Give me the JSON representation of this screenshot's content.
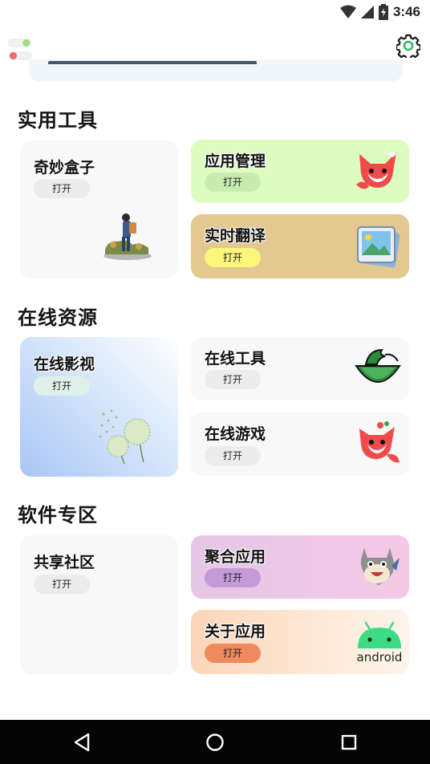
{
  "status_bar": {
    "time": "3:46"
  },
  "sections": [
    {
      "title": "实用工具"
    },
    {
      "title": "在线资源"
    },
    {
      "title": "软件专区"
    }
  ],
  "cards": {
    "qimiao": {
      "title": "奇妙盒子",
      "button": "打开"
    },
    "app_manage": {
      "title": "应用管理",
      "button": "打开"
    },
    "translate": {
      "title": "实时翻译",
      "button": "打开"
    },
    "video": {
      "title": "在线影视",
      "button": "打开"
    },
    "online_tools": {
      "title": "在线工具",
      "button": "打开"
    },
    "games": {
      "title": "在线游戏",
      "button": "打开"
    },
    "community": {
      "title": "共享社区",
      "button": "打开"
    },
    "aggregate": {
      "title": "聚合应用",
      "button": "打开"
    },
    "about": {
      "title": "关于应用",
      "button": "打开",
      "logo_text": "android"
    }
  },
  "colors": {
    "app_manage_bg": "#dcfcc0",
    "translate_bg": "#e3c890",
    "translate_btn": "#fbf57a",
    "aggregate_btn": "#c59ad9",
    "about_btn": "#ef8a5e",
    "android_green": "#3ddc84"
  },
  "icons": [
    "wifi-icon",
    "signal-icon",
    "battery-icon",
    "settings-gear-icon",
    "back-icon",
    "home-icon",
    "recents-icon"
  ]
}
